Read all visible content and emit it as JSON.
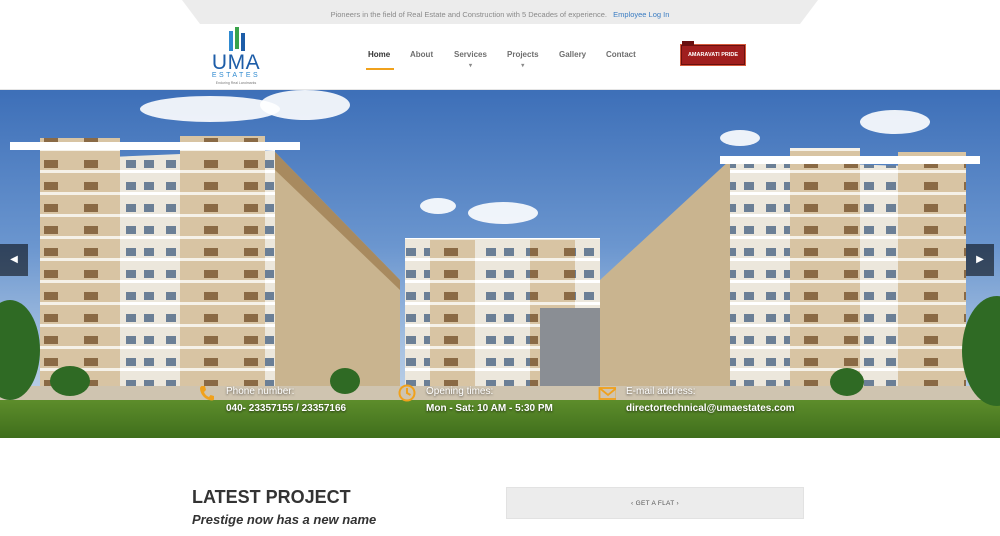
{
  "topbar": {
    "tagline": "Pioneers in the field of Real Estate and Construction with 5 Decades of experience.",
    "employee_login": "Employee Log In"
  },
  "logo": {
    "word": "UMA",
    "sub": "ESTATES",
    "tag": "Enduring Real Landmarks"
  },
  "nav": {
    "items": [
      {
        "label": "Home",
        "active": true
      },
      {
        "label": "About"
      },
      {
        "label": "Services",
        "dropdown": true
      },
      {
        "label": "Projects",
        "dropdown": true
      },
      {
        "label": "Gallery"
      },
      {
        "label": "Contact"
      }
    ],
    "caret": "▾"
  },
  "badge": {
    "label": "AMARAVATI PRIDE"
  },
  "slider": {
    "prev": "◀",
    "next": "▶"
  },
  "contact": {
    "phone_label": "Phone number:",
    "phone_value": "040- 23357155 / 23357166",
    "hours_label": "Opening times:",
    "hours_value": "Mon - Sat: 10 AM - 5:30 PM",
    "email_label": "E-mail address:",
    "email_value": "directortechnical@umaestates.com"
  },
  "latest": {
    "title": "LATEST PROJECT",
    "subtitle": "Prestige now has a new name"
  },
  "cta": {
    "label": "‹ GET A FLAT ›"
  },
  "colors": {
    "accent": "#f0a11c",
    "brand_blue": "#1d5da8",
    "badge_red": "#a01e1e"
  },
  "icons": [
    "phone-icon",
    "clock-icon",
    "mail-icon",
    "chevron-left-icon",
    "chevron-right-icon"
  ]
}
